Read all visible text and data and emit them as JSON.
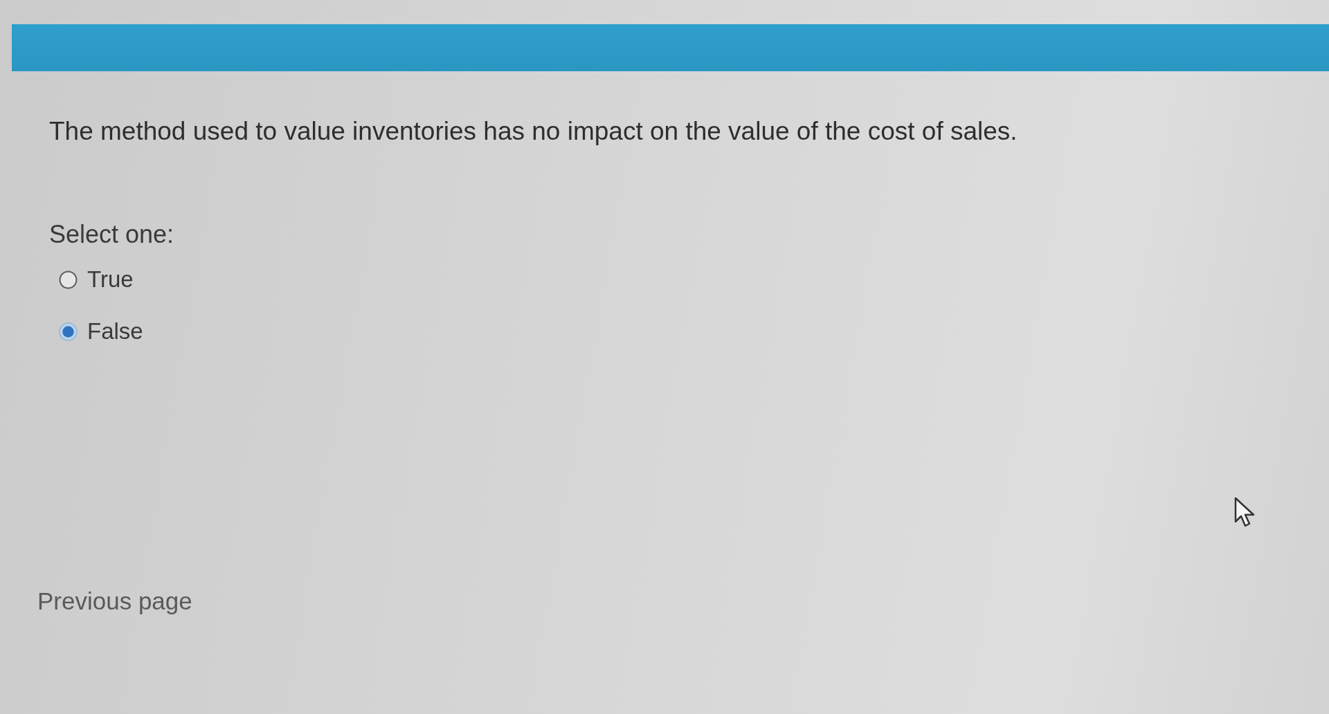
{
  "question": {
    "text": "The method used to value inventories has no impact on the value of the cost of sales."
  },
  "prompt": "Select one:",
  "options": [
    {
      "label": "True",
      "selected": false
    },
    {
      "label": "False",
      "selected": true
    }
  ],
  "navigation": {
    "previous": "Previous page"
  }
}
